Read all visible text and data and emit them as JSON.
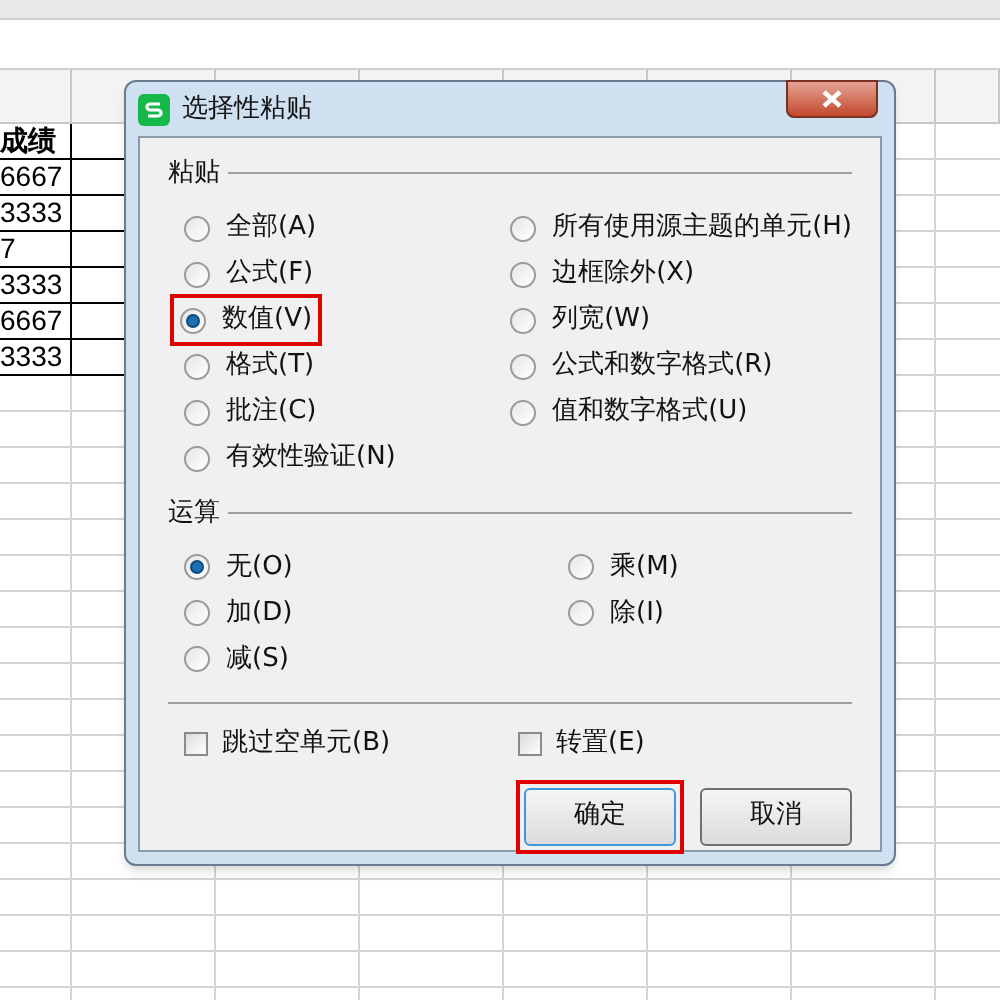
{
  "sheet": {
    "header": "成绩",
    "rows": [
      "6667",
      "3333",
      "7",
      "3333",
      "6667",
      "3333"
    ]
  },
  "dialog": {
    "title": "选择性粘贴",
    "paste": {
      "label": "粘贴",
      "options": [
        {
          "label": "全部(A)",
          "selected": false,
          "highlighted": false
        },
        {
          "label": "公式(F)",
          "selected": false,
          "highlighted": false
        },
        {
          "label": "数值(V)",
          "selected": true,
          "highlighted": true
        },
        {
          "label": "格式(T)",
          "selected": false,
          "highlighted": false
        },
        {
          "label": "批注(C)",
          "selected": false,
          "highlighted": false
        },
        {
          "label": "有效性验证(N)",
          "selected": false,
          "highlighted": false
        },
        {
          "label": "所有使用源主题的单元(H)",
          "selected": false,
          "highlighted": false
        },
        {
          "label": "边框除外(X)",
          "selected": false,
          "highlighted": false
        },
        {
          "label": "列宽(W)",
          "selected": false,
          "highlighted": false
        },
        {
          "label": "公式和数字格式(R)",
          "selected": false,
          "highlighted": false
        },
        {
          "label": "值和数字格式(U)",
          "selected": false,
          "highlighted": false
        }
      ]
    },
    "operation": {
      "label": "运算",
      "options": [
        {
          "label": "无(O)",
          "selected": true
        },
        {
          "label": "加(D)",
          "selected": false
        },
        {
          "label": "减(S)",
          "selected": false
        },
        {
          "label": "乘(M)",
          "selected": false
        },
        {
          "label": "除(I)",
          "selected": false
        }
      ]
    },
    "checks": [
      {
        "label": "跳过空单元(B)",
        "checked": false
      },
      {
        "label": "转置(E)",
        "checked": false
      }
    ],
    "buttons": [
      {
        "label": "确定",
        "default": true,
        "highlighted": true
      },
      {
        "label": "取消",
        "default": false,
        "highlighted": false
      }
    ]
  }
}
